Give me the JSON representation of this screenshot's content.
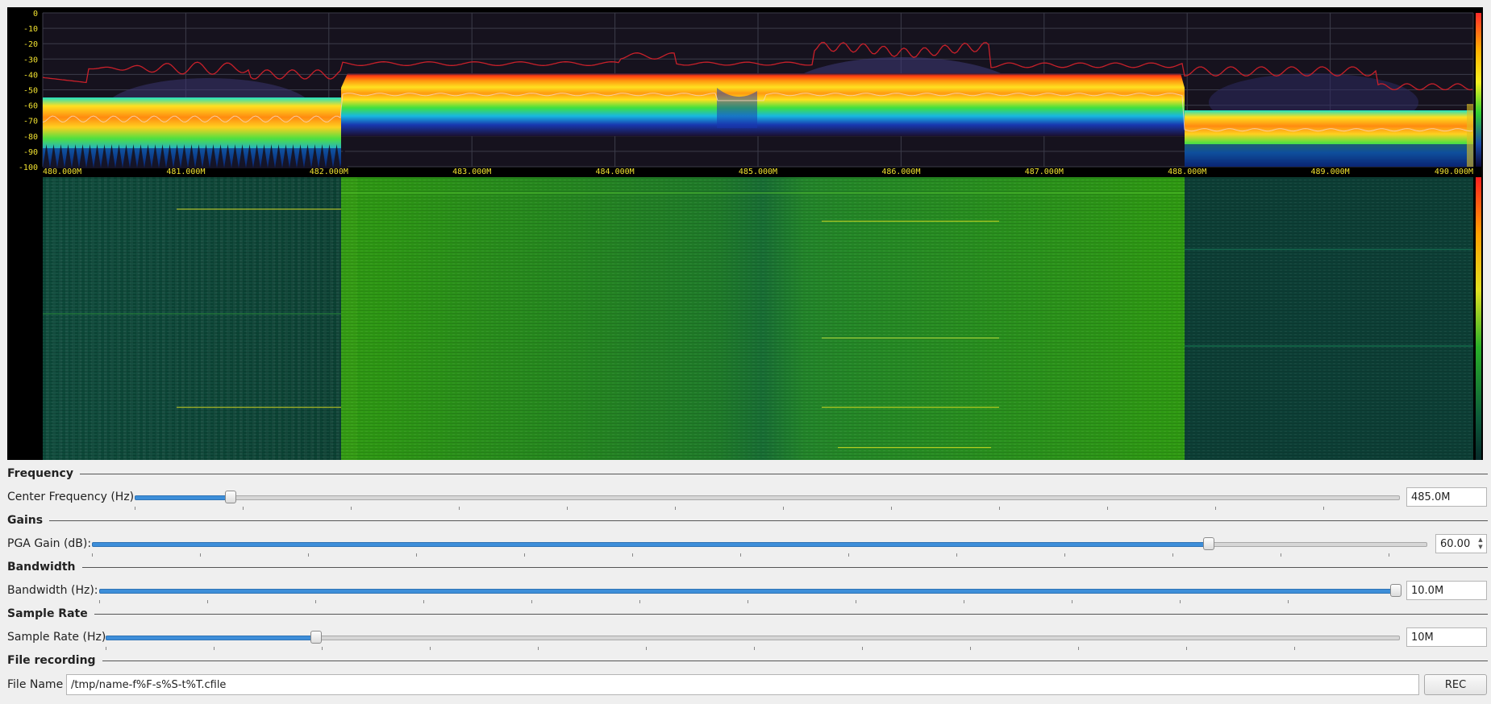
{
  "spectrum": {
    "y_ticks": [
      "0",
      "-10",
      "-20",
      "-30",
      "-40",
      "-50",
      "-60",
      "-70",
      "-80",
      "-90",
      "-100"
    ],
    "x_ticks": [
      "480.000M",
      "481.000M",
      "482.000M",
      "483.000M",
      "484.000M",
      "485.000M",
      "486.000M",
      "487.000M",
      "488.000M",
      "489.000M",
      "490.000M"
    ],
    "colors": {
      "axis_label": "#f0e130",
      "peak_hold": "#c8202a",
      "grid": "#3c3c4a"
    }
  },
  "frequency": {
    "section_title": "Frequency",
    "label": "Center Frequency (Hz)",
    "value": "485.0M",
    "slider_fraction": 0.075
  },
  "gains": {
    "section_title": "Gains",
    "label": "PGA Gain (dB):",
    "value": "60.00",
    "slider_fraction": 0.836
  },
  "bandwidth": {
    "section_title": "Bandwidth",
    "label": "Bandwidth (Hz):",
    "value": "10.0M",
    "slider_fraction": 1.0
  },
  "sample_rate": {
    "section_title": "Sample Rate",
    "label": "Sample Rate (Hz)",
    "value": "10M",
    "slider_fraction": 0.162
  },
  "file_recording": {
    "section_title": "File recording",
    "label": "File Name",
    "value": "/tmp/name-f%F-s%S-t%T.cfile",
    "button_label": "REC"
  }
}
